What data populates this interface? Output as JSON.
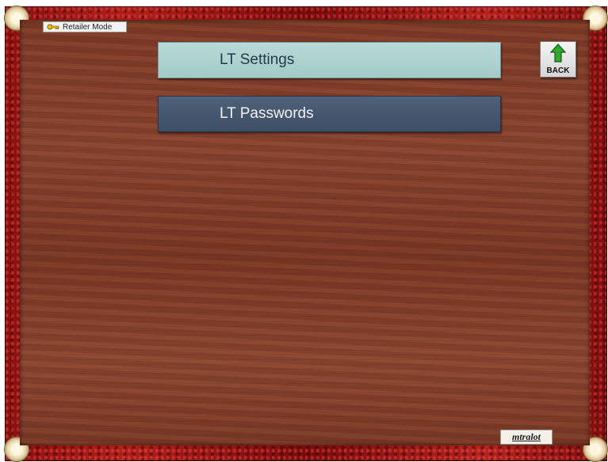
{
  "app": {
    "mode_badge": "Retailer Mode",
    "mode_icon": "key-icon"
  },
  "menu": {
    "items": [
      {
        "label": "LT Settings",
        "state": "selected",
        "bg": "#a3cbc8"
      },
      {
        "label": "LT Passwords",
        "state": "normal",
        "bg": "#3d4f66"
      }
    ]
  },
  "nav": {
    "back_label": "BACK",
    "back_icon": "up-arrow-icon",
    "back_icon_color": "#2faa2f"
  },
  "branding": {
    "logo_text": "mtralot"
  },
  "colors": {
    "frame": "#9a1a16",
    "wood": "#7e3b27"
  }
}
